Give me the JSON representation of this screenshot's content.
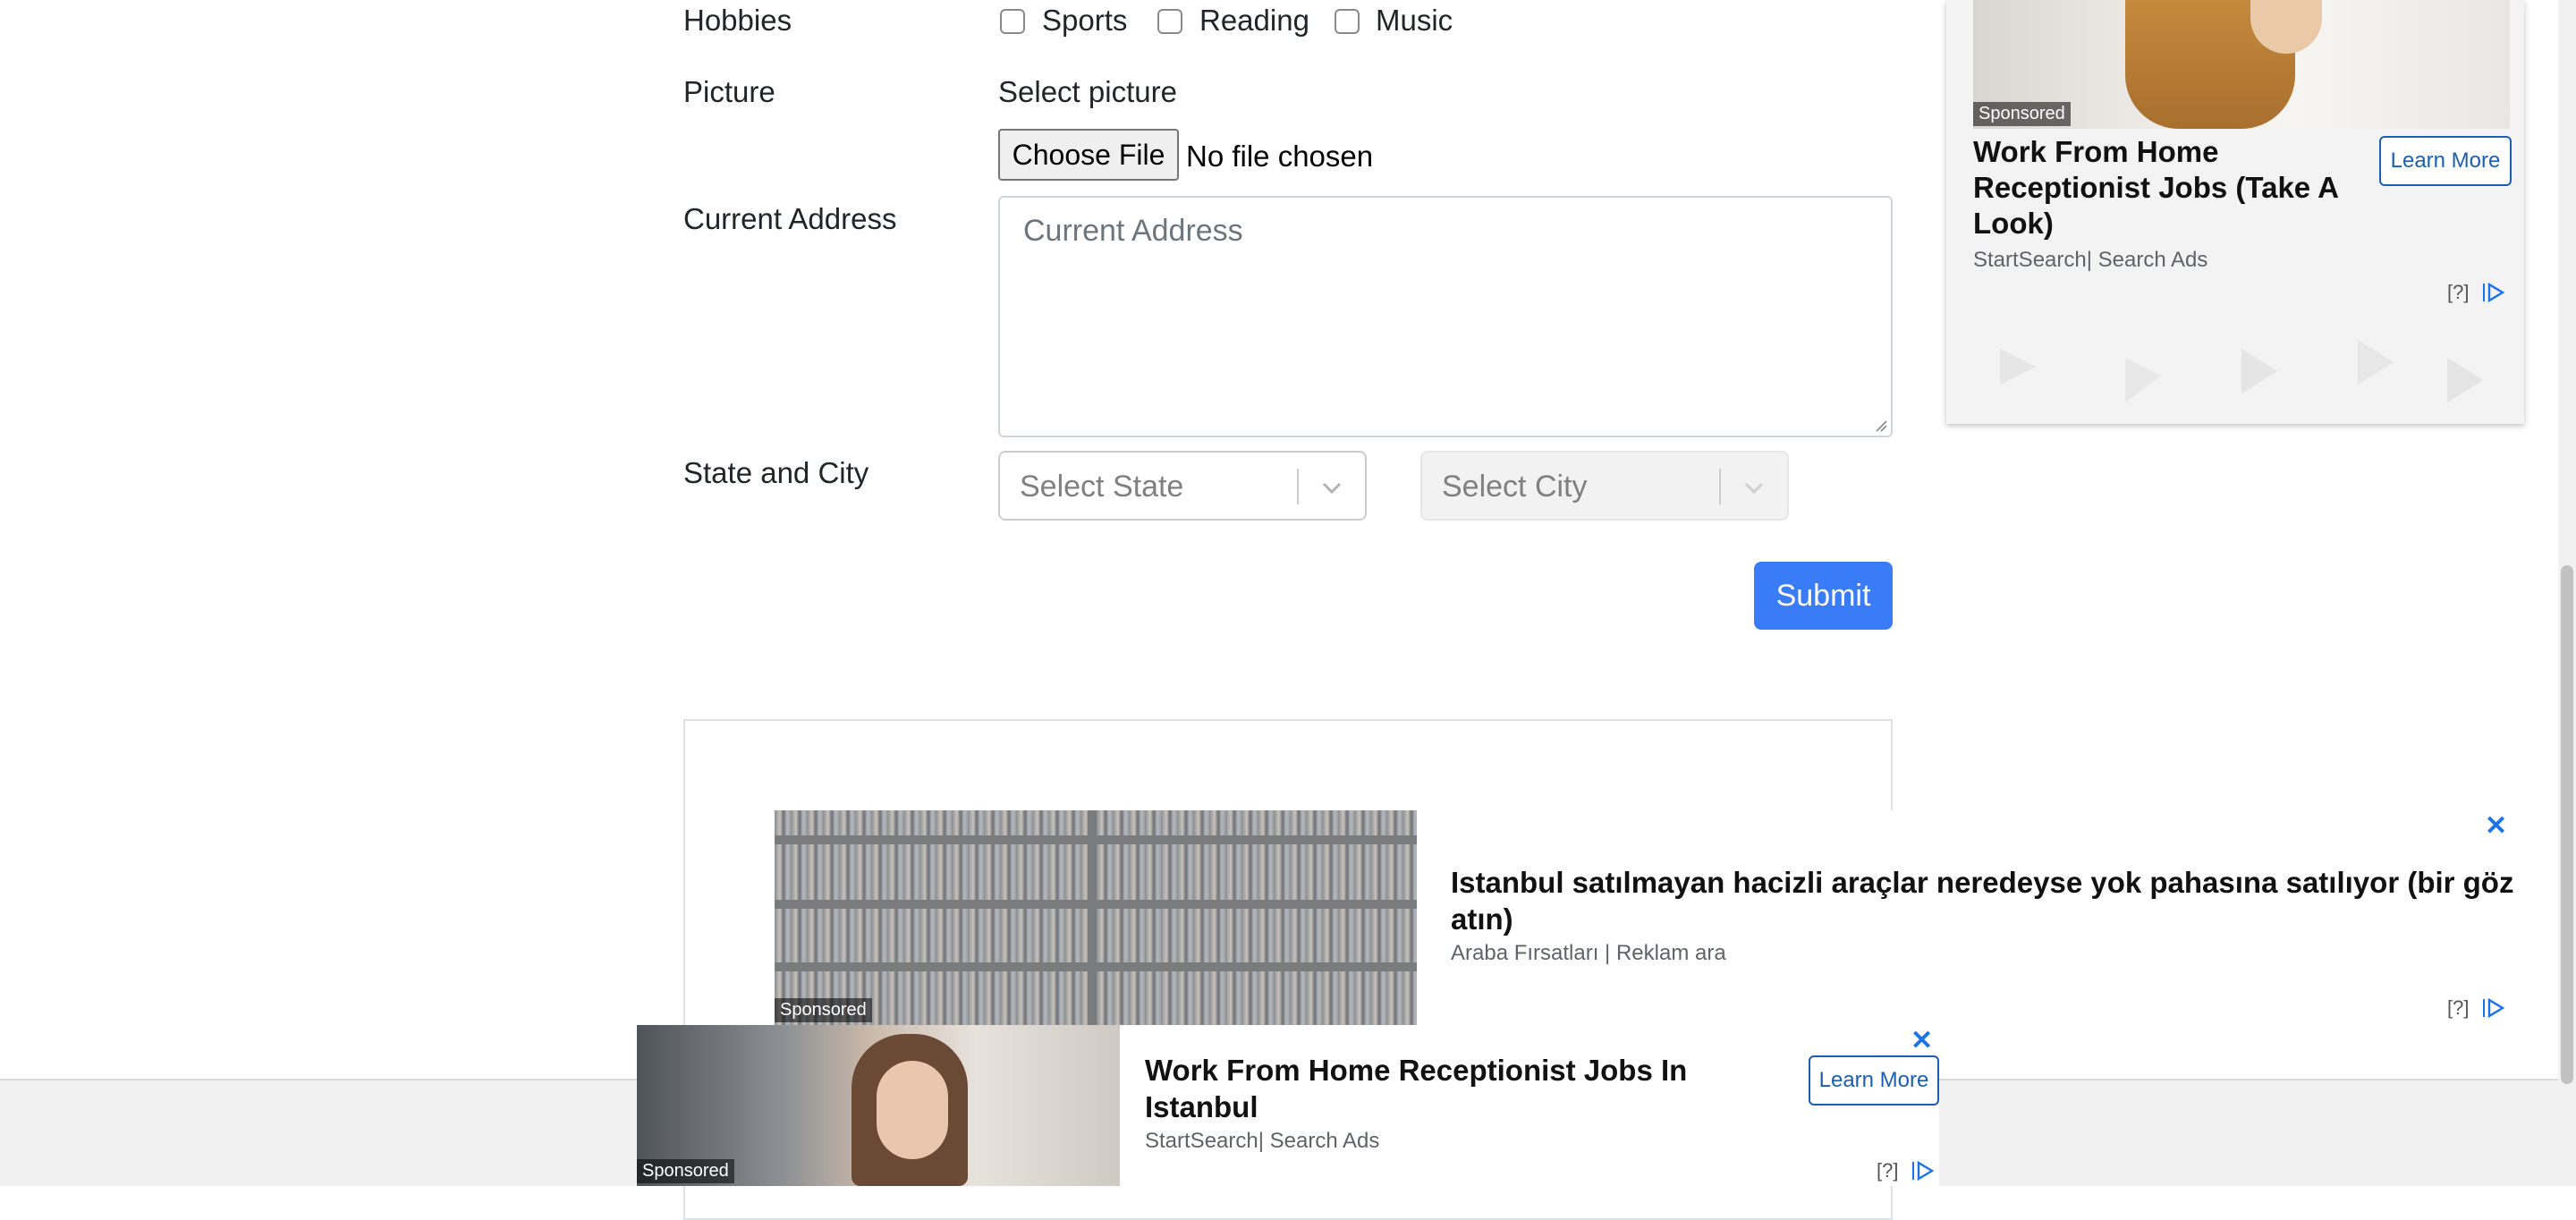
{
  "form": {
    "hobbies_label": "Hobbies",
    "hobbies": [
      {
        "label": "Sports",
        "checked": false
      },
      {
        "label": "Reading",
        "checked": false
      },
      {
        "label": "Music",
        "checked": false
      }
    ],
    "picture_label": "Picture",
    "picture_prompt": "Select picture",
    "file_button": "Choose File",
    "file_status": "No file chosen",
    "address_label": "Current Address",
    "address_placeholder": "Current Address",
    "state_city_label": "State and City",
    "state_placeholder": "Select State",
    "city_placeholder": "Select City",
    "submit_label": "Submit"
  },
  "ads": {
    "side_ad": {
      "sponsored": "Sponsored",
      "title": "Work From Home Receptionist Jobs (Take A Look)",
      "source": "StartSearch| Search Ads",
      "cta": "Learn More",
      "adchoice": "[?]"
    },
    "middle_ad": {
      "sponsored": "Sponsored",
      "title": "Istanbul satılmayan hacizli araçlar neredeyse yok pahasına satılıyor (bir göz atın)",
      "source": "Araba Fırsatları | Reklam ara",
      "adchoice": "[?]"
    },
    "bottom_ad": {
      "sponsored": "Sponsored",
      "title": "Work From Home Receptionist Jobs In Istanbul",
      "source": "StartSearch| Search Ads",
      "cta": "Learn More",
      "adchoice": "[?]"
    },
    "close_icon": "close-icon",
    "adchoice_icon": "adchoices-icon",
    "accent_color": "#1a5fb4"
  },
  "colors": {
    "submit_bg": "#3a7cf7",
    "text": "#212529"
  }
}
